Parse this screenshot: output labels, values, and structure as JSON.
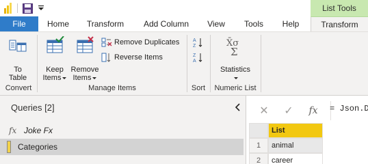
{
  "contextual": {
    "group_label": "List Tools"
  },
  "tabs": [
    {
      "label": "File"
    },
    {
      "label": "Home"
    },
    {
      "label": "Transform"
    },
    {
      "label": "Add Column"
    },
    {
      "label": "View"
    },
    {
      "label": "Tools"
    },
    {
      "label": "Help"
    },
    {
      "label": "Transform"
    }
  ],
  "ribbon": {
    "convert": {
      "group_label": "Convert",
      "to_table_line1": "To",
      "to_table_line2": "Table"
    },
    "manage_items": {
      "group_label": "Manage Items",
      "keep_items_line1": "Keep",
      "keep_items_line2": "Items",
      "remove_items_line1": "Remove",
      "remove_items_line2": "Items",
      "remove_duplicates": "Remove Duplicates",
      "reverse_items": "Reverse Items"
    },
    "sort": {
      "group_label": "Sort"
    },
    "numeric_list": {
      "group_label": "Numeric List",
      "statistics": "Statistics"
    }
  },
  "queries": {
    "header": "Queries [2]",
    "items": [
      {
        "name": "Joke Fx",
        "icon": "function-icon"
      },
      {
        "name": "Categories",
        "icon": "list-icon"
      }
    ]
  },
  "formula_bar": {
    "text": "= Json.D"
  },
  "grid": {
    "column": "List",
    "rows": [
      {
        "num": "1",
        "value": "animal"
      },
      {
        "num": "2",
        "value": "career"
      }
    ]
  },
  "colors": {
    "file_tab": "#2f7cc9",
    "contextual_header": "#c8e8b0",
    "column_header": "#f2c811",
    "ribbon_bg": "#f3f2f1"
  }
}
